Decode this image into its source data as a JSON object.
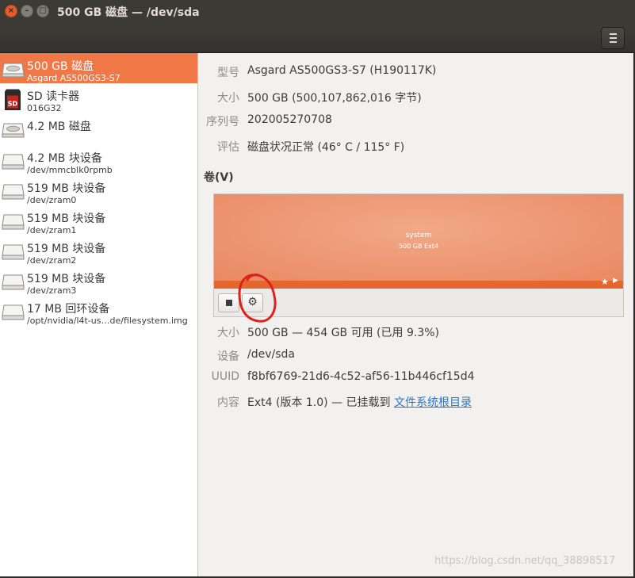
{
  "window": {
    "title": "500 GB 磁盘 — /dev/sda"
  },
  "header": {
    "menu_icon": "hamburger-menu-icon"
  },
  "sidebar": {
    "items": [
      {
        "name": "500 GB 磁盘",
        "sub": "Asgard AS500GS3-S7",
        "icon": "hard-disk-icon",
        "selected": true
      },
      {
        "name": "SD 读卡器",
        "sub": "016G32",
        "icon": "sd-card-icon"
      },
      {
        "name": "4.2 MB 磁盘",
        "sub": "",
        "icon": "hard-disk-icon"
      },
      {
        "name": "4.2 MB 块设备",
        "sub": "/dev/mmcblk0rpmb",
        "icon": "block-device-icon"
      },
      {
        "name": "519 MB 块设备",
        "sub": "/dev/zram0",
        "icon": "block-device-icon"
      },
      {
        "name": "519 MB 块设备",
        "sub": "/dev/zram1",
        "icon": "block-device-icon"
      },
      {
        "name": "519 MB 块设备",
        "sub": "/dev/zram2",
        "icon": "block-device-icon"
      },
      {
        "name": "519 MB 块设备",
        "sub": "/dev/zram3",
        "icon": "block-device-icon"
      },
      {
        "name": "17 MB 回环设备",
        "sub": "/opt/nvidia/l4t-us…de/filesystem.img",
        "icon": "loop-device-icon"
      }
    ]
  },
  "drive": {
    "model_label": "型号",
    "model": "Asgard AS500GS3-S7 (H190117K)",
    "size_label": "大小",
    "size": "500 GB (500,107,862,016 字节)",
    "serial_label": "序列号",
    "serial": "202005270708",
    "assessment_label": "评估",
    "assessment": "磁盘状况正常 (46° C / 115° F)"
  },
  "volumes": {
    "section_title": "卷(V)",
    "partition": {
      "name": "system",
      "detail": "500 GB Ext4"
    },
    "star_icon": "★",
    "play_icon": "▶",
    "stop_icon": "stop-icon",
    "gear_icon": "⚙"
  },
  "partition_info": {
    "size_label": "大小",
    "size": "500 GB — 454 GB 可用 (已用 9.3%)",
    "device_label": "设备",
    "device": "/dev/sda",
    "uuid_label": "UUID",
    "uuid": "f8bf6769-21d6-4c52-af56-11b446cf15d4",
    "contents_label": "内容",
    "contents": "Ext4 (版本 1.0) — 已挂载到 ",
    "mount_link": "文件系统根目录"
  },
  "watermark": "https://blog.csdn.net/qq_38898517",
  "colors": {
    "accent": "#f07746",
    "partition": "#ee9a77",
    "close": "#e95b2a"
  }
}
